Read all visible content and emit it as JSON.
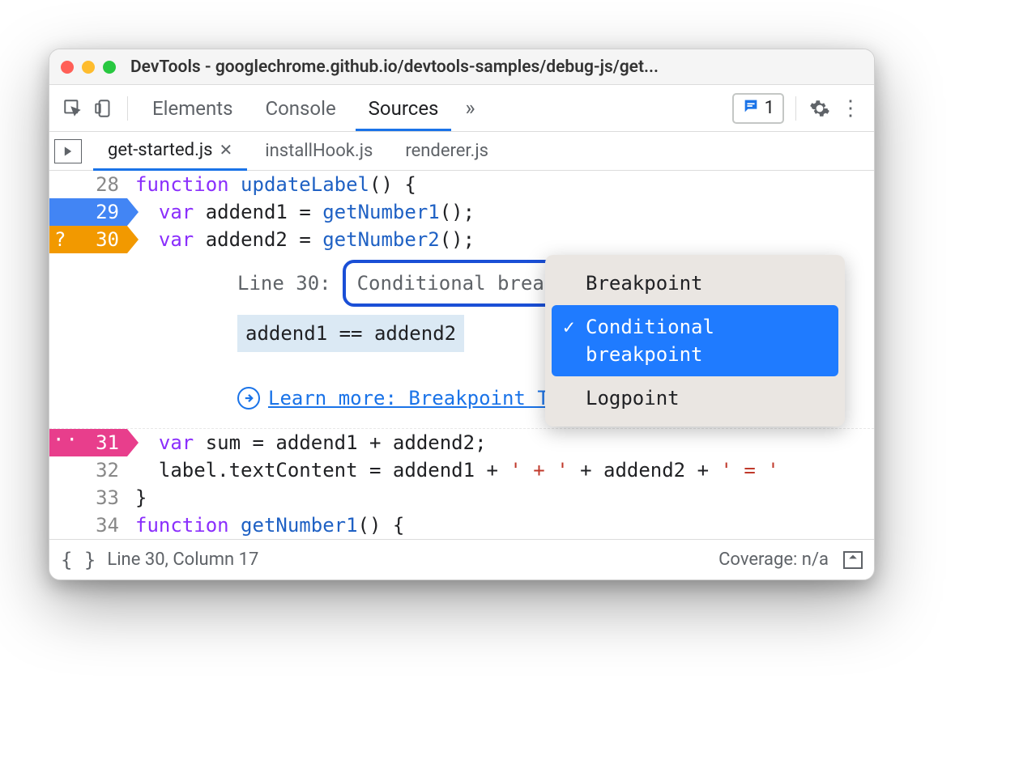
{
  "window": {
    "title": "DevTools - googlechrome.github.io/devtools-samples/debug-js/get..."
  },
  "toolbar": {
    "tabs": {
      "elements": "Elements",
      "console": "Console",
      "sources": "Sources"
    },
    "issues_count": "1"
  },
  "file_tabs": {
    "active": "get-started.js",
    "t1": "installHook.js",
    "t2": "renderer.js"
  },
  "code": {
    "l28": {
      "n": "28",
      "kw": "function",
      "fn": "updateLabel",
      "rest": "() {"
    },
    "l29": {
      "n": "29",
      "kw": "var",
      "id": "addend1",
      "rest": " = ",
      "fn": "getNumber1",
      "tail": "();"
    },
    "l30": {
      "n": "30",
      "q": "?",
      "kw": "var",
      "id": "addend2",
      "rest": " = ",
      "fn": "getNumber2",
      "tail": "();"
    },
    "l31": {
      "n": "31",
      "dd": "··",
      "kw": "var",
      "id": "sum",
      "rest": " = addend1 + addend2;"
    },
    "l32": {
      "n": "32",
      "text1": "label.textContent = addend1 + ",
      "s1": "' + '",
      "text2": " + addend2 + ",
      "s2": "' = '"
    },
    "l33": {
      "n": "33",
      "text": "}"
    },
    "l34": {
      "n": "34",
      "kw": "function",
      "fn": "getNumber1",
      "rest": "() {"
    }
  },
  "breakpoint_panel": {
    "line_label": "Line 30:",
    "dropdown_label": "Conditional breakpoint",
    "expression": "addend1 == addend2",
    "learn_more": "Learn more: Breakpoint Types"
  },
  "popup": {
    "opt1": "Breakpoint",
    "opt2": "Conditional breakpoint",
    "opt3": "Logpoint"
  },
  "status": {
    "pos": "Line 30, Column 17",
    "coverage": "Coverage: n/a"
  }
}
